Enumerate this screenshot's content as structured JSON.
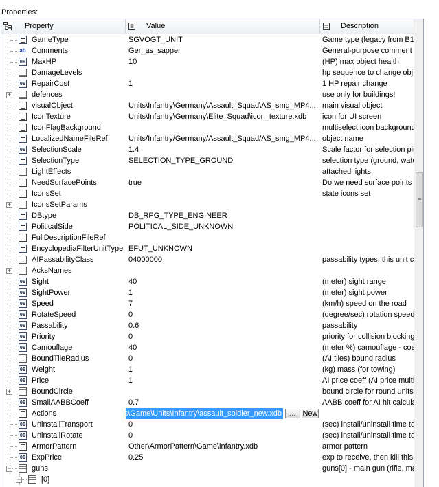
{
  "panel_title": "Properties:",
  "columns": {
    "property": "Property",
    "value": "Value",
    "description": "Description"
  },
  "editor": {
    "ellipsis_label": "...",
    "new_label": "New"
  },
  "rows": [
    {
      "name": "GameType",
      "value": "SGVOGT_UNIT",
      "desc": "Game type (legacy from B1,",
      "icon": "enum",
      "exp": ""
    },
    {
      "name": "Comments",
      "value": "Ger_as_sapper",
      "desc": "General-purpose comment",
      "icon": "str",
      "exp": ""
    },
    {
      "name": "MaxHP",
      "value": "10",
      "desc": "(HP) max object health",
      "icon": "num",
      "exp": ""
    },
    {
      "name": "DamageLevels",
      "value": "",
      "desc": "hp sequence to change obj",
      "icon": "grp",
      "exp": ""
    },
    {
      "name": "RepairCost",
      "value": "1",
      "desc": "1 HP repair change",
      "icon": "num",
      "exp": ""
    },
    {
      "name": "defences",
      "value": "",
      "desc": "use only for buildings!",
      "icon": "grp",
      "exp": "+"
    },
    {
      "name": "visualObject",
      "value": "Units\\Infantry\\Germany\\Assault_Squad\\AS_smg_MP4...",
      "desc": "main visual object",
      "icon": "ref",
      "exp": ""
    },
    {
      "name": "IconTexture",
      "value": "Units\\Infantry\\Germany\\Elite_Squad\\icon_texture.xdb",
      "desc": "icon for UI screen",
      "icon": "ref",
      "exp": ""
    },
    {
      "name": "IconFlagBackground",
      "value": "",
      "desc": "multiselect icon background",
      "icon": "ref",
      "exp": ""
    },
    {
      "name": "LocalizedNameFileRef",
      "value": "Units/Infantry/Germany/Assault_Squad/AS_smg_MP4...",
      "desc": "object name",
      "icon": "enum",
      "exp": ""
    },
    {
      "name": "SelectionScale",
      "value": "1.4",
      "desc": "Scale factor for selection pic",
      "icon": "num",
      "exp": ""
    },
    {
      "name": "SelectionType",
      "value": "SELECTION_TYPE_GROUND",
      "desc": "selection type (ground, wate",
      "icon": "enum",
      "exp": ""
    },
    {
      "name": "LightEffects",
      "value": "",
      "desc": "attached lights",
      "icon": "grp",
      "exp": ""
    },
    {
      "name": "NeedSurfacePoints",
      "value": "true",
      "desc": "Do we need surface points",
      "icon": "ref",
      "exp": ""
    },
    {
      "name": "IconsSet",
      "value": "",
      "desc": "state icons set",
      "icon": "ref",
      "exp": ""
    },
    {
      "name": "IconsSetParams",
      "value": "",
      "desc": "",
      "icon": "grp",
      "exp": "+"
    },
    {
      "name": "DBtype",
      "value": "DB_RPG_TYPE_ENGINEER",
      "desc": "",
      "icon": "enum",
      "exp": ""
    },
    {
      "name": "PoliticalSide",
      "value": "POLITICAL_SIDE_UNKNOWN",
      "desc": "",
      "icon": "enum",
      "exp": ""
    },
    {
      "name": "FullDescriptionFileRef",
      "value": "",
      "desc": "",
      "icon": "ref",
      "exp": ""
    },
    {
      "name": "EncyclopediaFilterUnitType",
      "value": "EFUT_UNKNOWN",
      "desc": "",
      "icon": "enum",
      "exp": ""
    },
    {
      "name": "AIPassabilityClass",
      "value": "04000000",
      "desc": "passability types, this unit ca",
      "icon": "bits",
      "exp": ""
    },
    {
      "name": "AcksNames",
      "value": "",
      "desc": "",
      "icon": "grp",
      "exp": "+"
    },
    {
      "name": "Sight",
      "value": "40",
      "desc": "(meter) sight range",
      "icon": "num",
      "exp": ""
    },
    {
      "name": "SightPower",
      "value": "1",
      "desc": "(meter) sight power",
      "icon": "num",
      "exp": ""
    },
    {
      "name": "Speed",
      "value": "7",
      "desc": "(km/h) speed on the road",
      "icon": "num",
      "exp": ""
    },
    {
      "name": "RotateSpeed",
      "value": "0",
      "desc": "(degree/sec) rotation speed",
      "icon": "num",
      "exp": ""
    },
    {
      "name": "Passability",
      "value": "0.6",
      "desc": "passability",
      "icon": "num",
      "exp": ""
    },
    {
      "name": "Priority",
      "value": "0",
      "desc": "priority for collision blocking",
      "icon": "num",
      "exp": ""
    },
    {
      "name": "Camouflage",
      "value": "40",
      "desc": "(meter %) camouflage - coef",
      "icon": "num",
      "exp": ""
    },
    {
      "name": "BoundTileRadius",
      "value": "0",
      "desc": "(AI tiles) bound radius",
      "icon": "bits",
      "exp": ""
    },
    {
      "name": "Weight",
      "value": "1",
      "desc": "(kg) mass (for towing)",
      "icon": "num",
      "exp": ""
    },
    {
      "name": "Price",
      "value": "1",
      "desc": "AI price coeff (AI price multi",
      "icon": "num",
      "exp": ""
    },
    {
      "name": "BoundCircle",
      "value": "",
      "desc": "bound circle for round units",
      "icon": "grp",
      "exp": "+"
    },
    {
      "name": "SmallAABBCoeff",
      "value": "0.7",
      "desc": "AABB coeff for AI hit calcula",
      "icon": "num",
      "exp": ""
    },
    {
      "name": "Actions",
      "value": "s\\Game\\Units\\Infantry\\assault_soldier_new.xdb",
      "desc": "",
      "icon": "ref",
      "exp": "",
      "selected": true
    },
    {
      "name": "UninstallTransport",
      "value": "0",
      "desc": "(sec) install/uninstall time to",
      "icon": "num",
      "exp": ""
    },
    {
      "name": "UninstallRotate",
      "value": "0",
      "desc": "(sec) install/uninstall time to",
      "icon": "num",
      "exp": ""
    },
    {
      "name": "ArmorPattern",
      "value": "Other\\ArmorPattern\\Game\\infantry.xdb",
      "desc": "armor pattern",
      "icon": "ref",
      "exp": ""
    },
    {
      "name": "ExpPrice",
      "value": "0.25",
      "desc": "exp to receive, then kill this",
      "icon": "num",
      "exp": ""
    },
    {
      "name": "guns",
      "value": "",
      "desc": "guns[0] - main gun (rifle, mac",
      "icon": "grp",
      "exp": "-"
    },
    {
      "name": "[0]",
      "value": "",
      "desc": "",
      "icon": "grp",
      "exp": "-",
      "indent": 1
    }
  ]
}
